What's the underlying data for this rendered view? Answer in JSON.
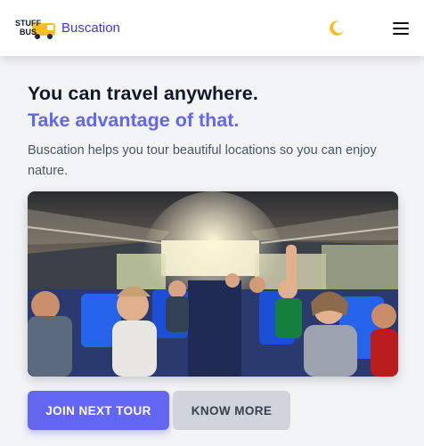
{
  "header": {
    "logo_text_top": "STUFF",
    "logo_text_bottom": "BUS",
    "brand_name": "Buscation",
    "theme_icon": "moon-icon",
    "menu_icon": "hamburger-menu-icon"
  },
  "hero": {
    "title": "You can travel anywhere.",
    "subtitle": "Take advantage of that.",
    "description": "Buscation helps you tour beautiful locations so you can enjoy nature.",
    "image_subject": "passengers inside a tour bus"
  },
  "actions": {
    "primary_label": "Join Next Tour",
    "secondary_label": "Know More"
  },
  "colors": {
    "accent": "#6366f1",
    "brand": "#4338ca",
    "moon": "#fbbf24",
    "secondary_button": "#d1d5db"
  }
}
